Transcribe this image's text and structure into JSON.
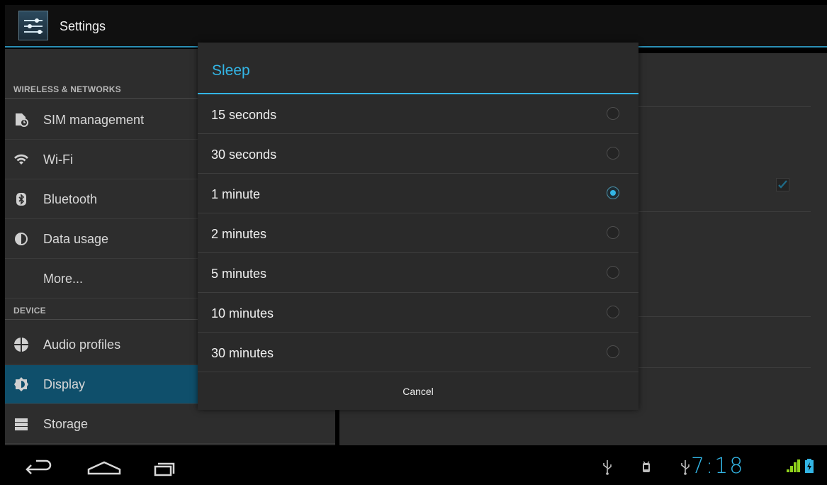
{
  "header": {
    "title": "Settings",
    "icon": "settings-sliders-icon"
  },
  "sidebar": {
    "sections": [
      {
        "label": "WIRELESS & NETWORKS"
      },
      {
        "label": "DEVICE"
      }
    ],
    "items": [
      {
        "label": "SIM management",
        "icon": "sim-icon"
      },
      {
        "label": "Wi-Fi",
        "icon": "wifi-icon"
      },
      {
        "label": "Bluetooth",
        "icon": "bluetooth-icon"
      },
      {
        "label": "Data usage",
        "icon": "data-usage-icon"
      },
      {
        "label": "More...",
        "icon": ""
      },
      {
        "label": "Audio profiles",
        "icon": "audio-profiles-icon"
      },
      {
        "label": "Display",
        "icon": "display-icon",
        "selected": true
      },
      {
        "label": "Storage",
        "icon": "storage-icon"
      }
    ]
  },
  "dialog": {
    "title": "Sleep",
    "options": [
      {
        "label": "15 seconds",
        "selected": false
      },
      {
        "label": "30 seconds",
        "selected": false
      },
      {
        "label": "1 minute",
        "selected": true
      },
      {
        "label": "2 minutes",
        "selected": false
      },
      {
        "label": "5 minutes",
        "selected": false
      },
      {
        "label": "10 minutes",
        "selected": false
      },
      {
        "label": "30 minutes",
        "selected": false
      }
    ],
    "cancel_label": "Cancel"
  },
  "statusbar": {
    "time": "7:18"
  },
  "colors": {
    "accent": "#33b5e5",
    "selected_bg": "#0f4f6b",
    "panel_bg": "#2d2d2d"
  }
}
